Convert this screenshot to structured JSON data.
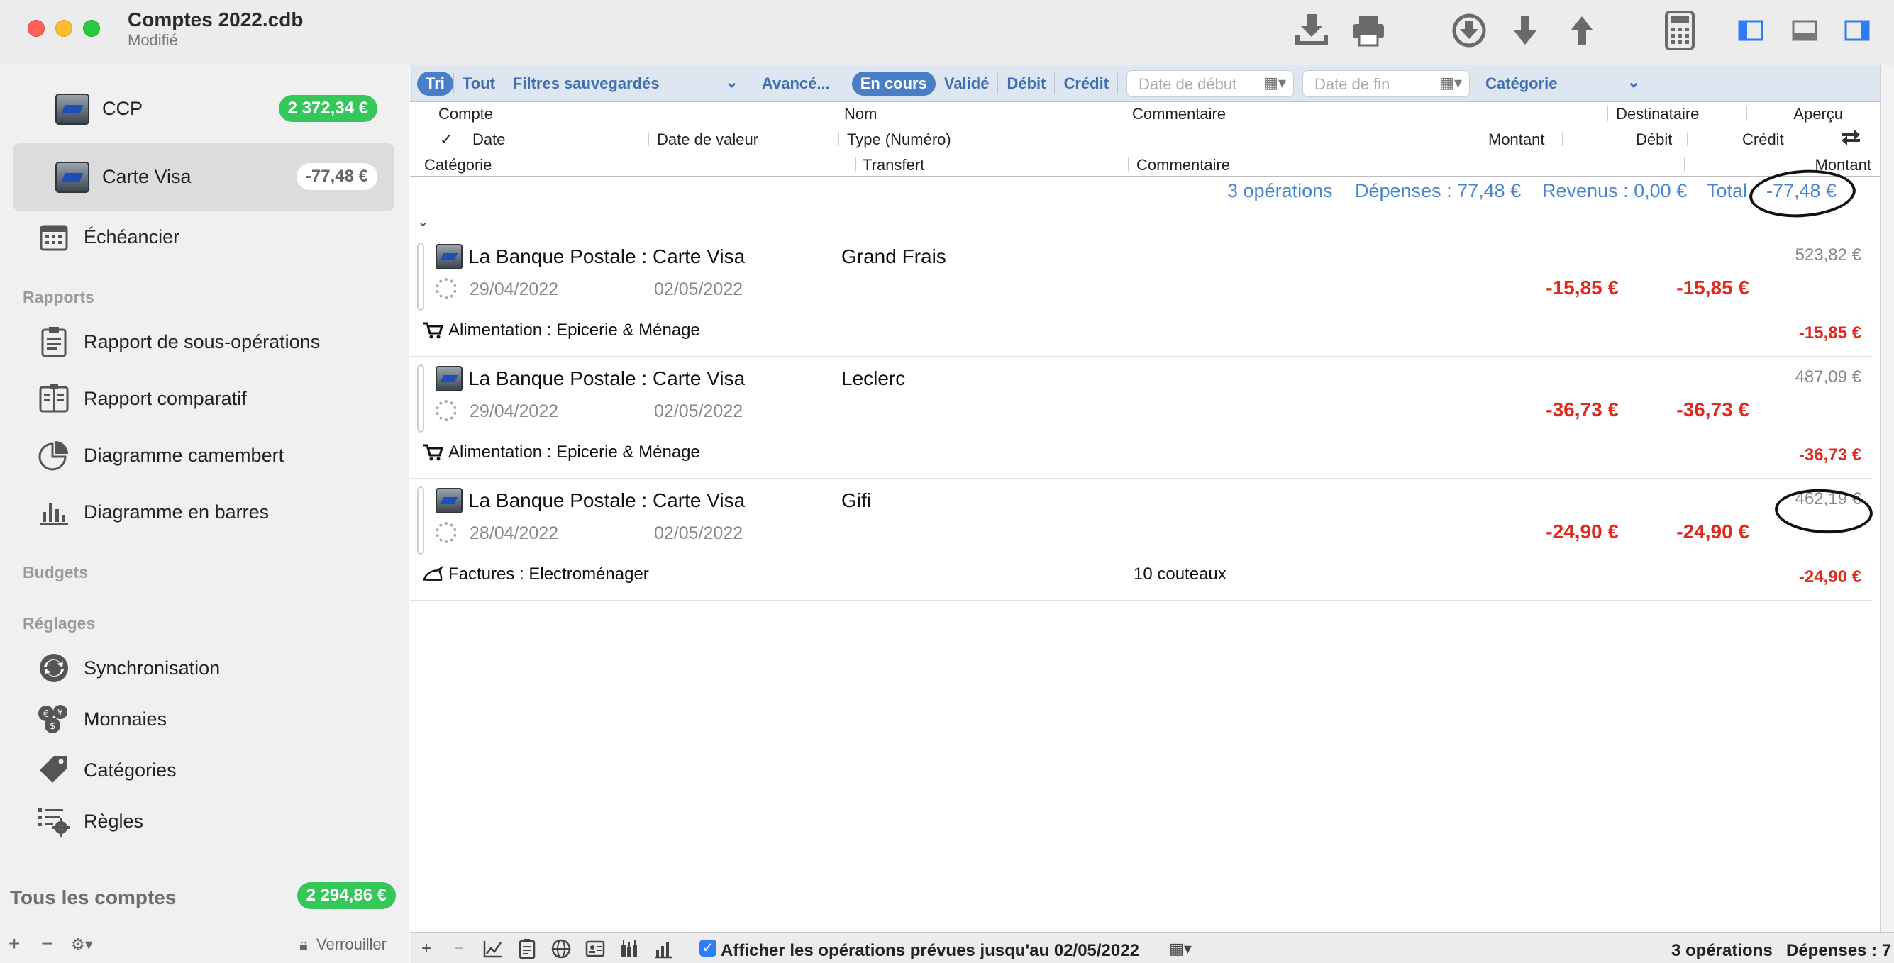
{
  "window": {
    "title": "Comptes 2022.cdb",
    "subtitle": "Modifié"
  },
  "toolbar_icons": [
    "import-icon",
    "print-icon",
    "download-circle-icon",
    "arrow-down-icon",
    "arrow-up-icon",
    "calculator-icon",
    "sidebar-left-icon",
    "panel-bottom-icon",
    "sidebar-right-icon"
  ],
  "sidebar": {
    "accounts": [
      {
        "name": "CCP",
        "balance": "2 372,34 €"
      },
      {
        "name": "Carte Visa",
        "balance": "-77,48 €"
      }
    ],
    "schedule": "Échéancier",
    "reports_title": "Rapports",
    "reports": [
      "Rapport de sous-opérations",
      "Rapport comparatif",
      "Diagramme camembert",
      "Diagramme en barres"
    ],
    "budgets_title": "Budgets",
    "settings_title": "Réglages",
    "settings": [
      "Synchronisation",
      "Monnaies",
      "Catégories",
      "Règles"
    ],
    "all_accounts_label": "Tous les comptes",
    "all_accounts_balance": "2 294,86 €",
    "lock_label": "Verrouiller"
  },
  "filters": {
    "sort": "Tri",
    "all": "Tout",
    "saved": "Filtres sauvegardés",
    "advanced": "Avancé...",
    "pending": "En cours",
    "validated": "Validé",
    "debit": "Débit",
    "credit": "Crédit",
    "start_date_placeholder": "Date de début",
    "end_date_placeholder": "Date de fin",
    "category": "Catégorie"
  },
  "columns": {
    "account": "Compte",
    "name": "Nom",
    "comment": "Commentaire",
    "recipient": "Destinataire",
    "preview": "Aperçu",
    "check": "✓",
    "date": "Date",
    "value_date": "Date de valeur",
    "type": "Type (Numéro)",
    "amount": "Montant",
    "debit": "Débit",
    "credit": "Crédit",
    "category": "Catégorie",
    "transfer": "Transfert",
    "comment2": "Commentaire",
    "amount2": "Montant"
  },
  "summary": {
    "count": "3 opérations",
    "expenses": "Dépenses : 77,48 €",
    "income": "Revenus : 0,00 €",
    "total_label": "Total",
    "total_value": "-77,48 €"
  },
  "transactions": [
    {
      "account": "La Banque Postale : Carte Visa",
      "payee": "Grand Frais",
      "date": "29/04/2022",
      "value_date": "02/05/2022",
      "balance": "523,82 €",
      "amount": "-15,85 €",
      "debit": "-15,85 €",
      "category": "Alimentation : Epicerie & Ménage",
      "category_icon": "cart-icon",
      "comment": "",
      "total": "-15,85 €"
    },
    {
      "account": "La Banque Postale : Carte Visa",
      "payee": "Leclerc",
      "date": "29/04/2022",
      "value_date": "02/05/2022",
      "balance": "487,09 €",
      "amount": "-36,73 €",
      "debit": "-36,73 €",
      "category": "Alimentation : Epicerie & Ménage",
      "category_icon": "cart-icon",
      "comment": "",
      "total": "-36,73 €"
    },
    {
      "account": "La Banque Postale : Carte Visa",
      "payee": "Gifi",
      "date": "28/04/2022",
      "value_date": "02/05/2022",
      "balance": "462,19 €",
      "amount": "-24,90 €",
      "debit": "-24,90 €",
      "category": "Factures : Electroménager",
      "category_icon": "iron-icon",
      "comment": "10 couteaux",
      "total": "-24,90 €"
    }
  ],
  "bottombar": {
    "show_planned_label": "Afficher les opérations prévues jusqu'au 02/05/2022",
    "count": "3 opérations",
    "expenses": "Dépenses : 7"
  },
  "colors": {
    "accent": "#4a7fc7",
    "negative": "#e02a1f",
    "badge_green": "#34c759",
    "summary_blue": "#4a86cf"
  }
}
